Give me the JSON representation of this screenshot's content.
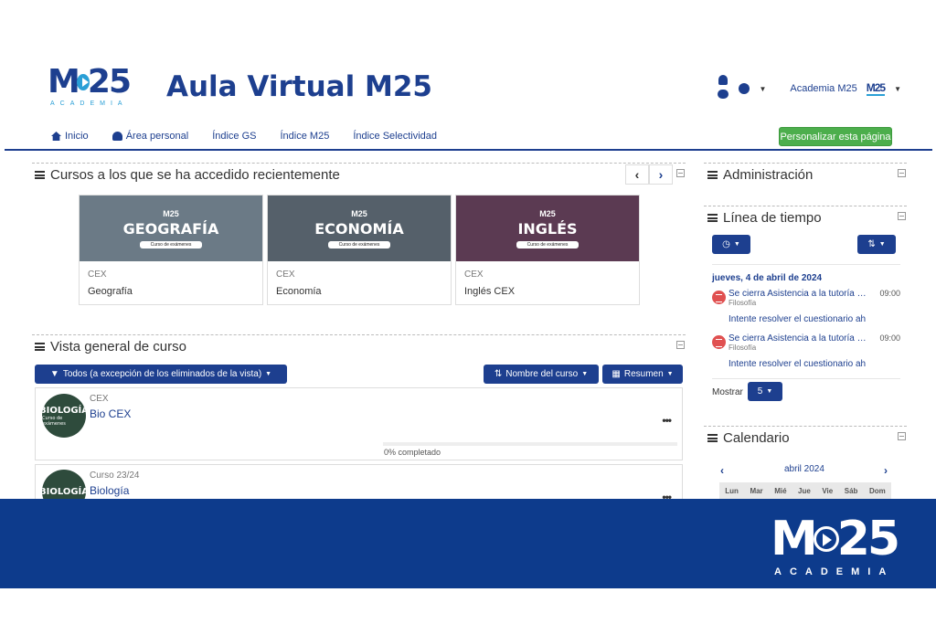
{
  "header": {
    "logo_text": "M25",
    "logo_sub": "ACADEMIA",
    "site_title": "Aula Virtual M25",
    "user_name": "Academia M25",
    "user_logo": "M25"
  },
  "nav": {
    "items": [
      {
        "label": "Inicio",
        "icon": "home-icon"
      },
      {
        "label": "Área personal",
        "icon": "dashboard-icon"
      },
      {
        "label": "Índice GS"
      },
      {
        "label": "Índice M25"
      },
      {
        "label": "Índice Selectividad"
      }
    ],
    "customize_label": "Personalizar esta página"
  },
  "recent": {
    "title": "Cursos a los que se ha accedido recientemente",
    "prev": "‹",
    "next": "›",
    "courses": [
      {
        "banner": "GEOGRAFÍA",
        "banner_logo": "M25",
        "banner_sub": "Curso de exámenes",
        "category": "CEX",
        "name": "Geografía",
        "color": "#6b7a86"
      },
      {
        "banner": "ECONOMÍA",
        "banner_logo": "M25",
        "banner_sub": "Curso de exámenes",
        "category": "CEX",
        "name": "Economía",
        "color": "#55606a"
      },
      {
        "banner": "INGLÉS",
        "banner_logo": "M25",
        "banner_sub": "Curso de exámenes",
        "category": "CEX",
        "name": "Inglés CEX",
        "color": "#5b3a52"
      }
    ]
  },
  "overview": {
    "title": "Vista general de curso",
    "filter_label": "Todos (a excepción de los eliminados de la vista)",
    "sort_label": "Nombre del curso",
    "view_label": "Resumen",
    "items": [
      {
        "avatar": "BIOLOGÍA",
        "avatar_sub": "Curso de exámenes",
        "category": "CEX",
        "name": "Bio CEX",
        "progress": "0% completado",
        "progress_value": 0
      },
      {
        "avatar": "BIOLOGÍA",
        "avatar_sub": "",
        "category": "Curso 23/24",
        "name": "Biología"
      }
    ],
    "more": "•••"
  },
  "admin": {
    "title": "Administración"
  },
  "timeline": {
    "title": "Línea de tiempo",
    "date": "jueves, 4 de abril de 2024",
    "events": [
      {
        "title": "Se cierra Asistencia a la tutoría …",
        "subject": "Filosofía",
        "time": "09:00",
        "action": "Intente resolver el cuestionario ah"
      },
      {
        "title": "Se cierra Asistencia a la tutoría …",
        "subject": "Filosofía",
        "time": "09:00",
        "action": "Intente resolver el cuestionario ah"
      }
    ],
    "show_label": "Mostrar",
    "show_value": "5"
  },
  "calendar": {
    "title": "Calendario",
    "month": "abril 2024",
    "prev": "‹",
    "next": "›",
    "days": [
      "Lun",
      "Mar",
      "Mié",
      "Jue",
      "Vie",
      "Sáb",
      "Dom"
    ]
  },
  "footer": {
    "logo_text": "M25",
    "logo_sub": "ACADEMIA"
  },
  "colors": {
    "brand": "#1d3f8f",
    "accent": "#2a9fd6",
    "green": "#4cae4c",
    "band": "#0d3b8c",
    "event": "#e05050"
  }
}
